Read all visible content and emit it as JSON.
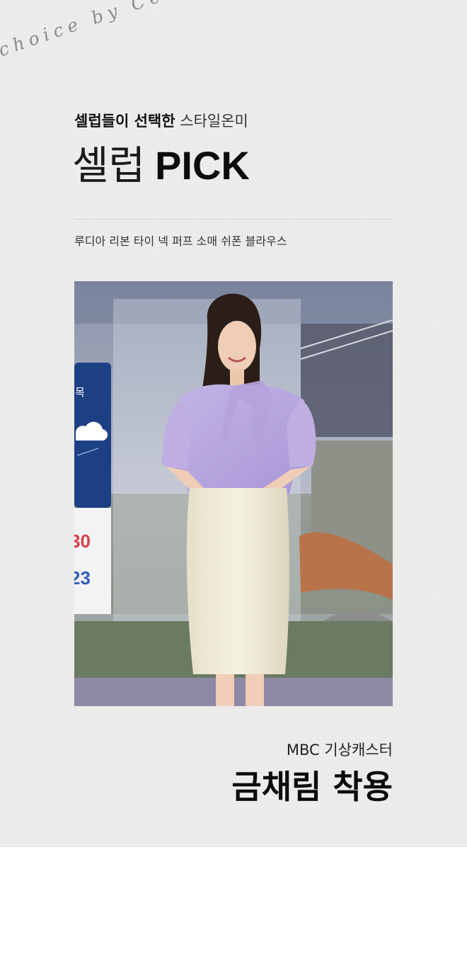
{
  "header": {
    "script_text": "choice by Celebrities",
    "subtitle_bold": "셀럽들이 선택한",
    "subtitle_light": "스타일온미",
    "title_korean": "셀럽",
    "title_english": "PICK"
  },
  "product": {
    "name": "루디아 리본 타이 넥 퍼프 소매 쉬폰 블라우스"
  },
  "photo": {
    "weather_panel_label": "목",
    "temp_high": "30",
    "temp_low": "23",
    "colors": {
      "blouse": "#b7a6dc",
      "skirt": "#f1ecd9",
      "weather_panel": "#1d3f83",
      "high_temp": "#d8404a",
      "low_temp": "#2f5fb6"
    }
  },
  "caption": {
    "subtitle": "MBC 기상캐스터",
    "title": "금채림 착용"
  }
}
